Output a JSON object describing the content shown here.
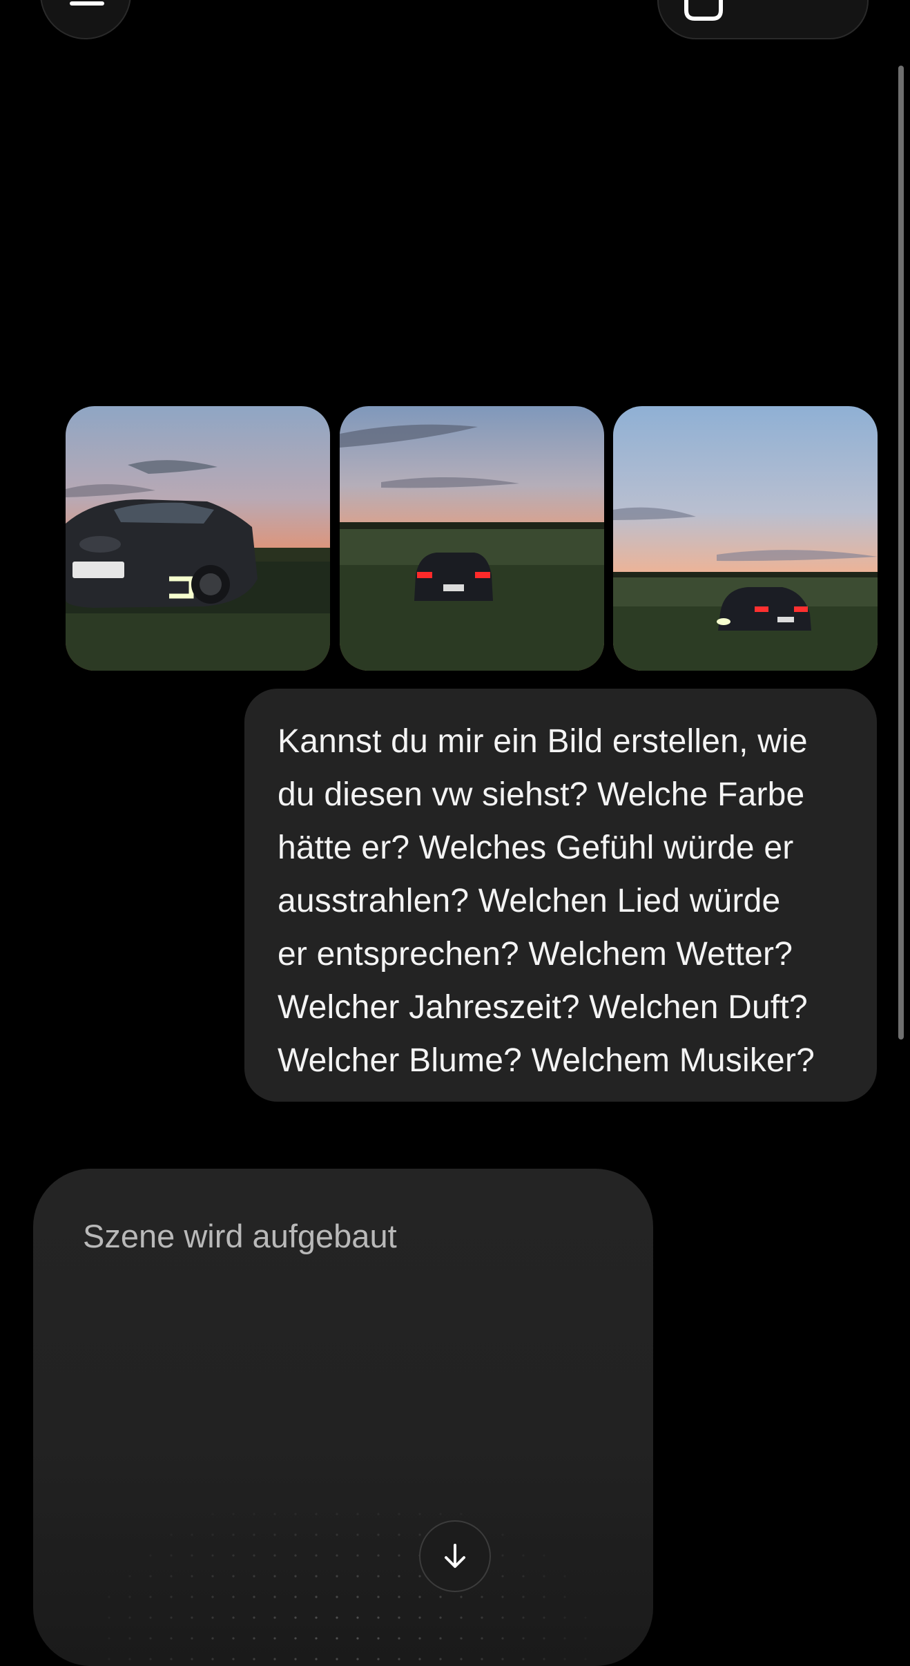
{
  "header": {
    "menu_icon": "menu-icon",
    "new_chat_icon": "compose-icon"
  },
  "attachments": [
    {
      "description": "car-front-sunset-photo"
    },
    {
      "description": "car-rear-field-photo"
    },
    {
      "description": "car-rear-field-wide-photo"
    }
  ],
  "user_message": {
    "lines": [
      "Kannst du mir ein Bild erstellen, wie",
      "du diesen vw siehst? Welche Farbe",
      "hätte er? Welches Gefühl würde er",
      "ausstrahlen? Welchen Lied würde",
      "er entsprechen? Welchem Wetter?",
      "Welcher Jahreszeit? Welchen Duft?",
      "Welcher Blume? Welchem Musiker?"
    ]
  },
  "assistant": {
    "status": "Szene wird aufgebaut"
  },
  "scroll_button_icon": "arrow-down-icon",
  "colors": {
    "background": "#000000",
    "bubble": "#232323",
    "card": "#242424",
    "text": "#f4f4f4",
    "muted": "#b9b9b9"
  }
}
